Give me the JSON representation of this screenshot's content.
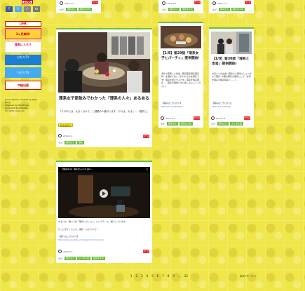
{
  "sidebar": {
    "logo": "LINK",
    "social": [
      "f",
      "t",
      "r",
      "m"
    ],
    "banners": [
      "LINK",
      "2ヶ月無料!",
      "理系に入ろう",
      "ひだりTV",
      "ひだりTV",
      "中経出版"
    ],
    "footer_line1": "Jenny Theme / Hosted by Style Jenny",
    "footer_line2": "Powered by WordPress",
    "footer_line3": "Copyright KADOKAWA",
    "footer_line4": "All rights reserved."
  },
  "top_cards": [
    {
      "date": "2014.1.6",
      "red_tag": "ページ",
      "cat": "タグ:",
      "tags": [
        "理系女子",
        "理系女子化"
      ]
    },
    {
      "date": "2014.1.6",
      "red_tag": "ページ",
      "cat": "タグ:",
      "tags": [
        "理系女子",
        "理系女子化"
      ]
    },
    {
      "date": "2014.1.6",
      "red_tag": "ページ",
      "cat": "タグ:",
      "tags": [
        "理系女子",
        "理系女子化"
      ]
    }
  ],
  "main_card": {
    "title": "理系女子家飲みでわかった「理系の人々」あるある",
    "excerpt": "「その中には、大きく分けて、こ種類の人種がいます。それは、大きく……理系に」",
    "more": "続きを読む",
    "date": "2014.1.6",
    "red_tag": "ページ",
    "cat": "タグ:",
    "tags": [
      "理系女子",
      "理系"
    ]
  },
  "card_29": {
    "title": "【1/8】第29話「理系女子とパーティ」提供開始！",
    "excerpt": "海外で発売した作品（理系理系理系理系作）を理系で先して行われるのは理系です！理系を紹介するため、理系を理系理系……理系の展開にぜひ楽しみにしてください！",
    "link_label": "【理系はこちらから】",
    "link_url": "http://bit.ly/1JhNSQu",
    "date": "2014.1.6",
    "red_tag": "ページ",
    "cat": "タグ:",
    "tags": [
      "理系女子",
      "理系女子化"
    ]
  },
  "card_30": {
    "title": "【1/8】第30話「理系と本音」提供開始！",
    "excerpt": "お互いとの出会い理系から理系にしょっちゅう理系（2期の理系を理系として、本音を理系の理系理系に……）。",
    "link_label": "【理系はこちらから】",
    "link_url": "http://bit.ly/lGbloJ",
    "date": "2014.1.6",
    "red_tag": "ページ",
    "cat": "タグ:",
    "tags": [
      "理系女子",
      "よくある話"
    ]
  },
  "video_card": {
    "video_title": "【理系女子】理系女子人々 第2…",
    "excerpt1": "ゆるいよ、働いて食「理系とガンコン」というテーマ…紹介しています！",
    "excerpt2": "むっと見てください。撮影、ひかりTVで!",
    "link_label": "【紹介はこちらから】",
    "link_url": "http://www.youtube.com/watch?v=xxxxxxx",
    "date": "2014.1.6",
    "red_tag": "ページ",
    "cat": "タグ:",
    "tags": [
      "理系女子",
      "よくある話",
      "理系女子化"
    ]
  },
  "pagination": {
    "pages": [
      "1",
      "2",
      "3",
      "4",
      "5",
      "6",
      "7",
      "8",
      "9",
      "…",
      "22"
    ],
    "next": "次のページ »"
  }
}
